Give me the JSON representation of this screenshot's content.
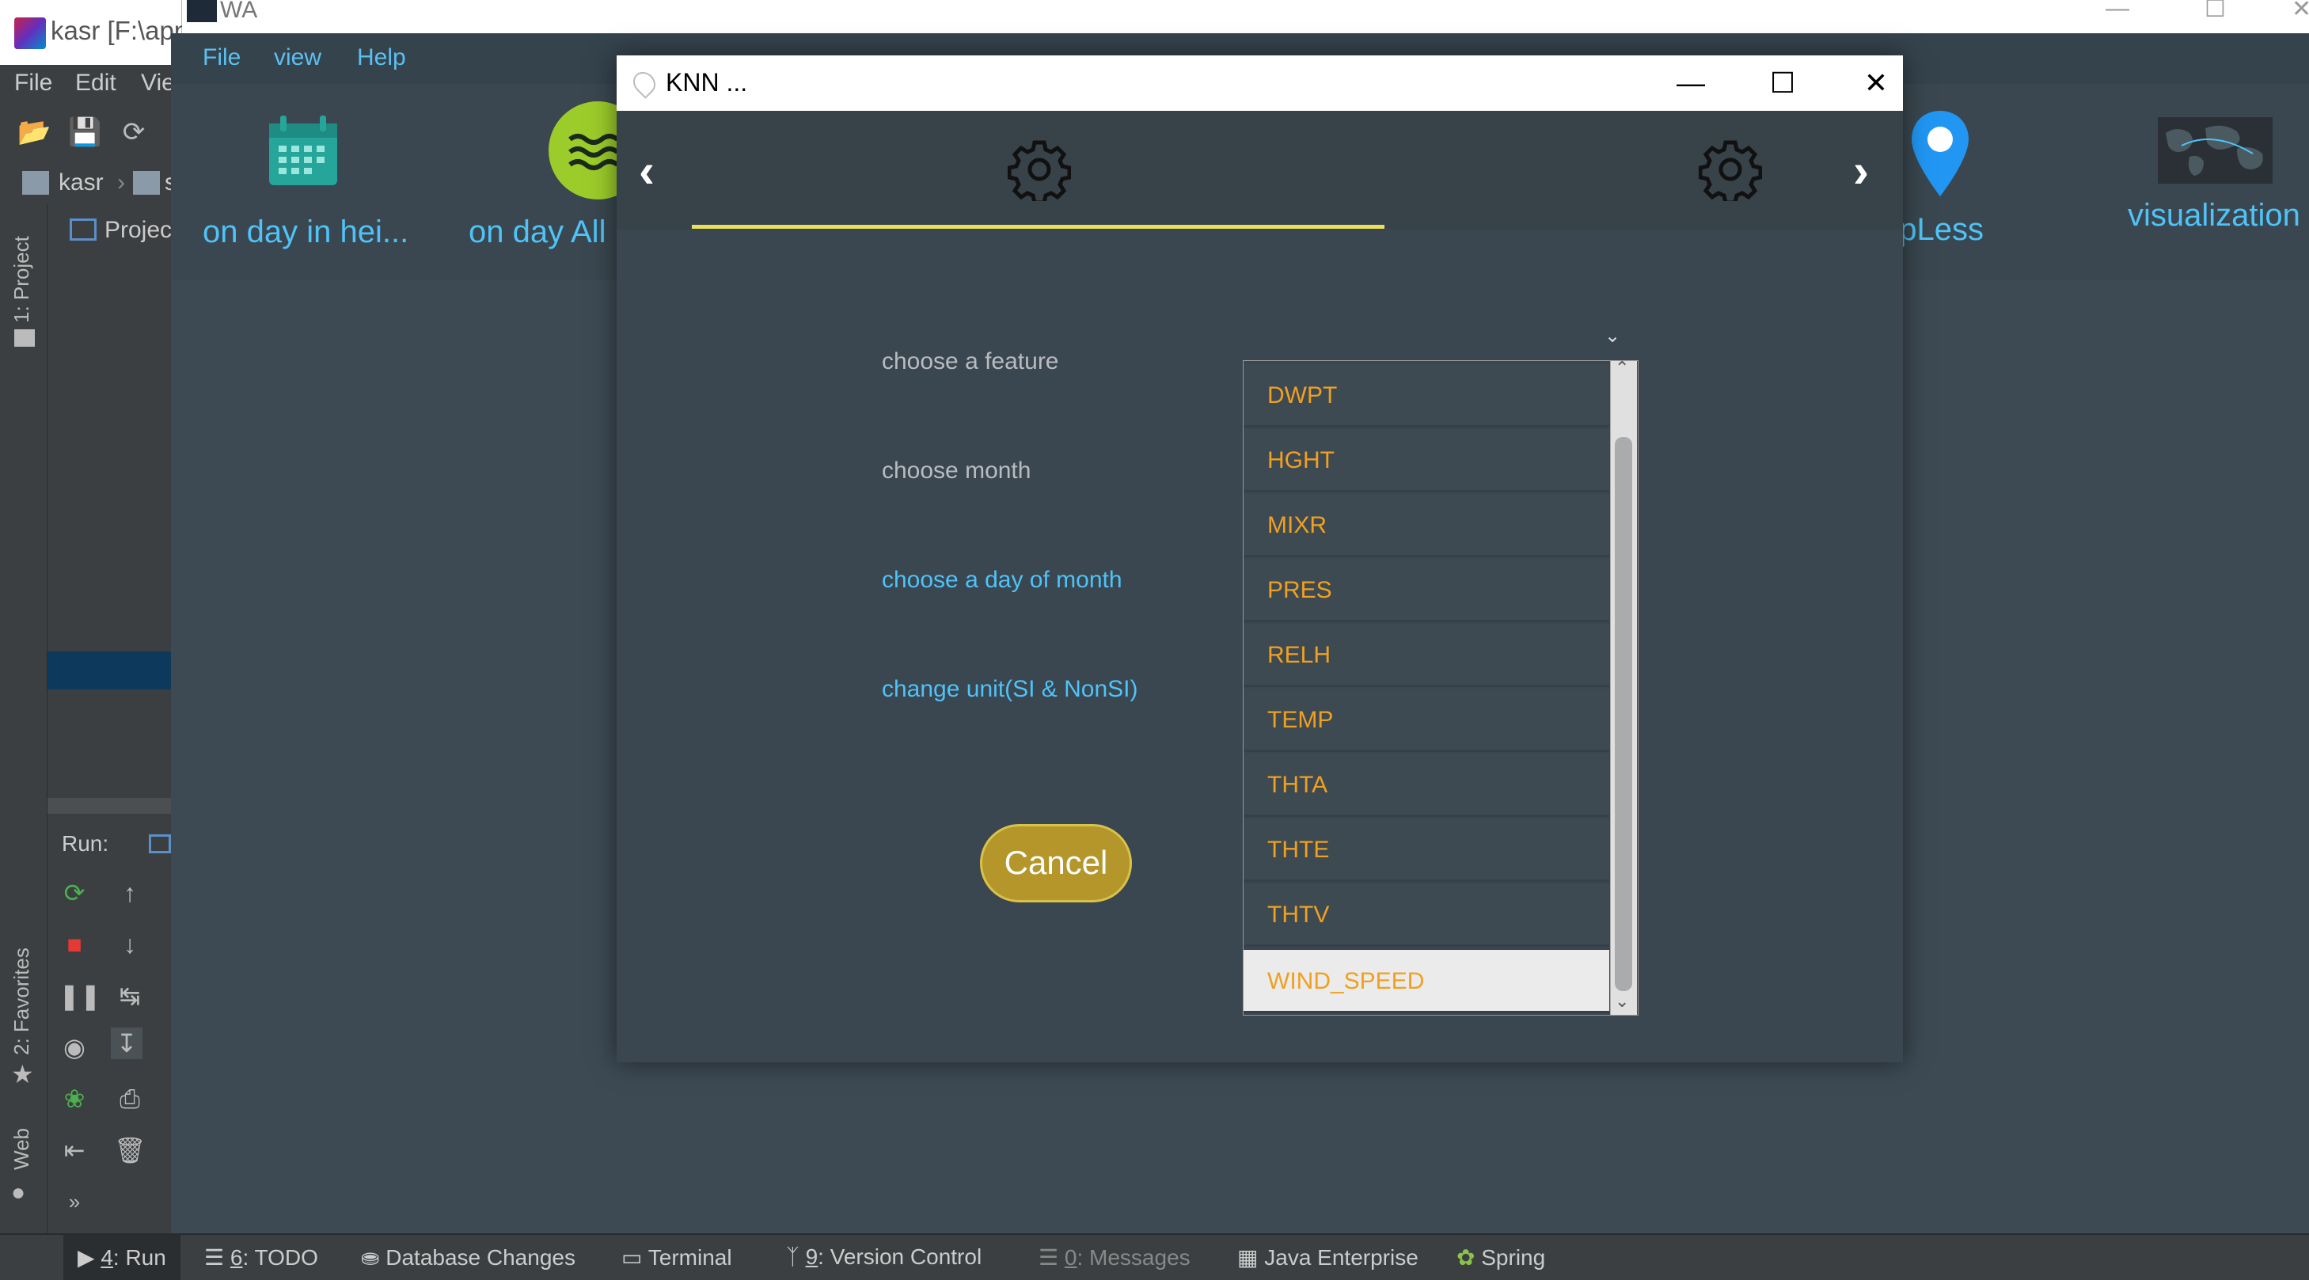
{
  "ide": {
    "title": "kasr [F:\\app",
    "menu": [
      "File",
      "Edit",
      "Vie"
    ],
    "breadcrumb": [
      "kasr",
      "s"
    ],
    "project_label": "Projec",
    "project_tab": "1: Project",
    "favorites_tab": "2: Favorites",
    "web_tab": "Web",
    "run_label": "Run:",
    "status_tabs": [
      {
        "key": "4",
        "label": ": Run"
      },
      {
        "key": "6",
        "label": ": TODO"
      },
      {
        "key": "",
        "label": "Database Changes"
      },
      {
        "key": "",
        "label": "Terminal"
      },
      {
        "key": "9",
        "label": ": Version Control"
      },
      {
        "key": "0",
        "label": ": Messages"
      },
      {
        "key": "",
        "label": "Java Enterprise"
      },
      {
        "key": "",
        "label": "Spring"
      }
    ]
  },
  "wa": {
    "title": "WA",
    "menu": [
      "File",
      "view",
      "Help"
    ],
    "tiles": [
      "on day in hei...",
      "on day All",
      "MapLess",
      "visualization"
    ]
  },
  "dialog": {
    "title": "KNN ...",
    "labels": {
      "feature": "choose a feature",
      "month": "choose month",
      "day": "choose a day of month",
      "unit": "change unit(SI & NonSI)"
    },
    "cancel": "Cancel",
    "features": [
      "DWPT",
      "HGHT",
      "MIXR",
      "PRES",
      "RELH",
      "TEMP",
      "THTA",
      "THTE",
      "THTV",
      "WIND_SPEED"
    ],
    "selected_feature": "WIND_SPEED"
  },
  "colors": {
    "accent_yellow": "#e8e05a",
    "link_blue": "#4fc3f7",
    "item_orange": "#f0a020",
    "cancel_gold": "#b4962a"
  }
}
